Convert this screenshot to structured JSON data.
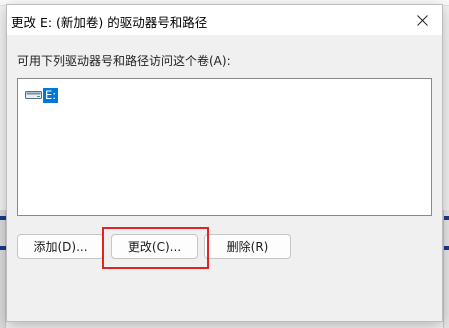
{
  "dialog": {
    "title": "更改 E: (新加卷) 的驱动器号和路径",
    "close_icon": "close-icon",
    "list_label": "可用下列驱动器号和路径访问这个卷(A):",
    "items": [
      {
        "label": "E:",
        "icon": "drive-icon",
        "selected": true
      }
    ],
    "buttons": {
      "add": "添加(D)...",
      "change": "更改(C)...",
      "delete": "删除(R)"
    }
  },
  "colors": {
    "selection": "#0078d7",
    "highlight_box": "#e02424"
  }
}
